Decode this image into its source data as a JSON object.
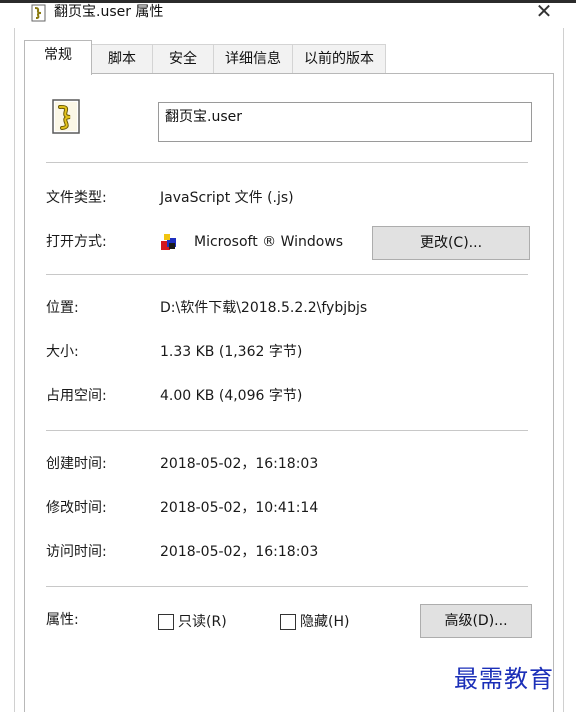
{
  "window": {
    "title": "翻页宝.user 属性",
    "close_glyph": "✕"
  },
  "tabs": [
    {
      "label": "常规",
      "active": true
    },
    {
      "label": "脚本",
      "active": false
    },
    {
      "label": "安全",
      "active": false
    },
    {
      "label": "详细信息",
      "active": false
    },
    {
      "label": "以前的版本",
      "active": false
    }
  ],
  "general": {
    "file_name": "翻页宝.user",
    "file_type_label": "文件类型:",
    "file_type_value": "JavaScript 文件 (.js)",
    "open_with_label": "打开方式:",
    "open_with_value": "Microsoft ® Windows",
    "change_button": "更改(C)...",
    "location_label": "位置:",
    "location_value": "D:\\软件下载\\2018.5.2.2\\fybjbjs",
    "size_label": "大小:",
    "size_value": "1.33 KB (1,362 字节)",
    "disk_size_label": "占用空间:",
    "disk_size_value": "4.00 KB (4,096 字节)",
    "created_label": "创建时间:",
    "created_value": "2018-05-02，16:18:03",
    "modified_label": "修改时间:",
    "modified_value": "2018-05-02，10:41:14",
    "accessed_label": "访问时间:",
    "accessed_value": "2018-05-02，16:18:03",
    "attributes_label": "属性:",
    "readonly_label": "只读(R)",
    "readonly_checked": false,
    "hidden_label": "隐藏(H)",
    "hidden_checked": false,
    "advanced_button": "高级(D)..."
  },
  "watermark": "最需教育",
  "icons": {
    "file": "script-file-icon",
    "app": "windows-script-host-icon",
    "close": "close-icon"
  },
  "colors": {
    "watermark": "#1b2fb8",
    "button_bg": "#e1e1e1",
    "separator": "#c8c8c8"
  }
}
